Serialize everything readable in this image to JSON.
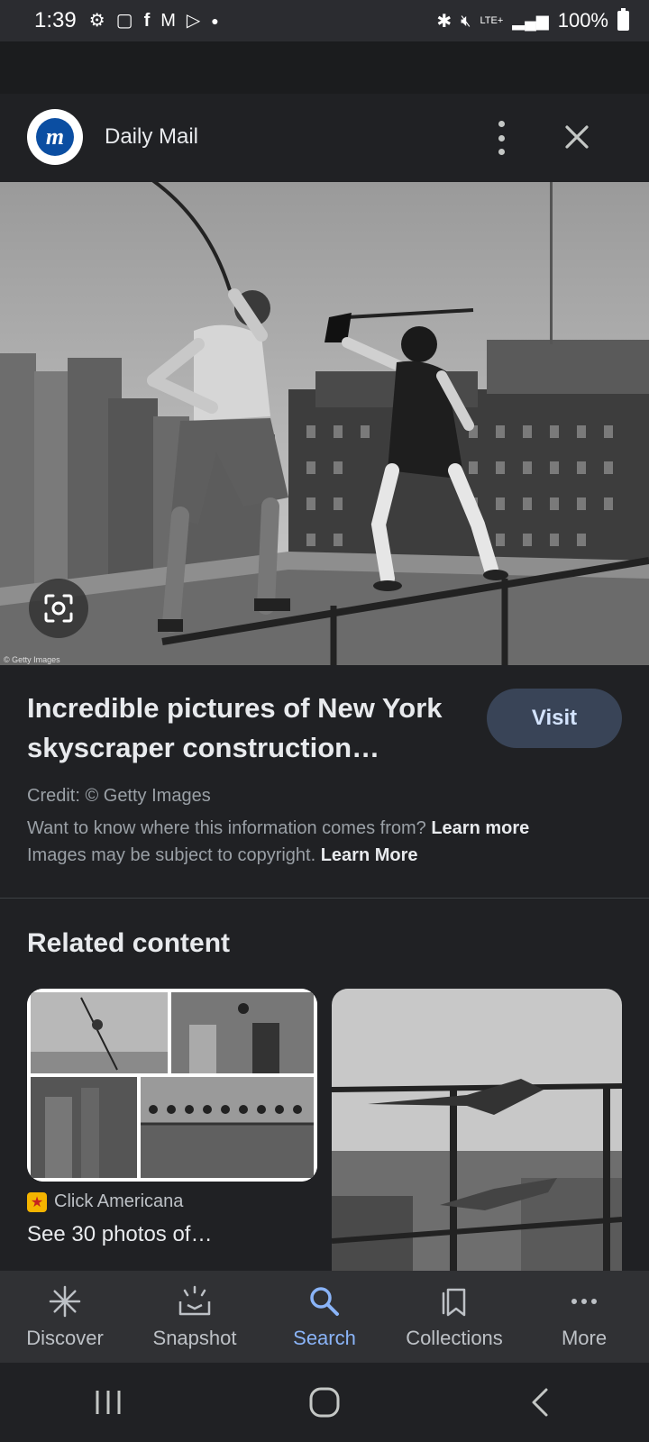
{
  "status_bar": {
    "time": "1:39",
    "battery": "100%",
    "network": "LTE+"
  },
  "source": {
    "name": "Daily Mail",
    "logo_letter": "m",
    "logo_color": "#0b4ea2"
  },
  "image": {
    "watermark": "© Getty Images"
  },
  "result": {
    "title": "Incredible pictures of New York skyscraper construction…",
    "visit_label": "Visit",
    "credit": "Credit: © Getty Images",
    "info_text": "Want to know where this information comes from?",
    "info_link": "Learn more",
    "copyright_text": "Images may be subject to copyright.",
    "copyright_link": "Learn More"
  },
  "related": {
    "heading": "Related content",
    "cards": [
      {
        "source": "Click Americana",
        "caption": "See 30 photos of…"
      }
    ]
  },
  "bottom_nav": {
    "items": [
      {
        "label": "Discover",
        "icon": "discover-icon"
      },
      {
        "label": "Snapshot",
        "icon": "snapshot-icon"
      },
      {
        "label": "Search",
        "icon": "search-icon",
        "active": true
      },
      {
        "label": "Collections",
        "icon": "collections-icon"
      },
      {
        "label": "More",
        "icon": "more-icon"
      }
    ]
  },
  "colors": {
    "background": "#202124",
    "accent": "#8ab4f8",
    "visit_button": "#394457"
  }
}
